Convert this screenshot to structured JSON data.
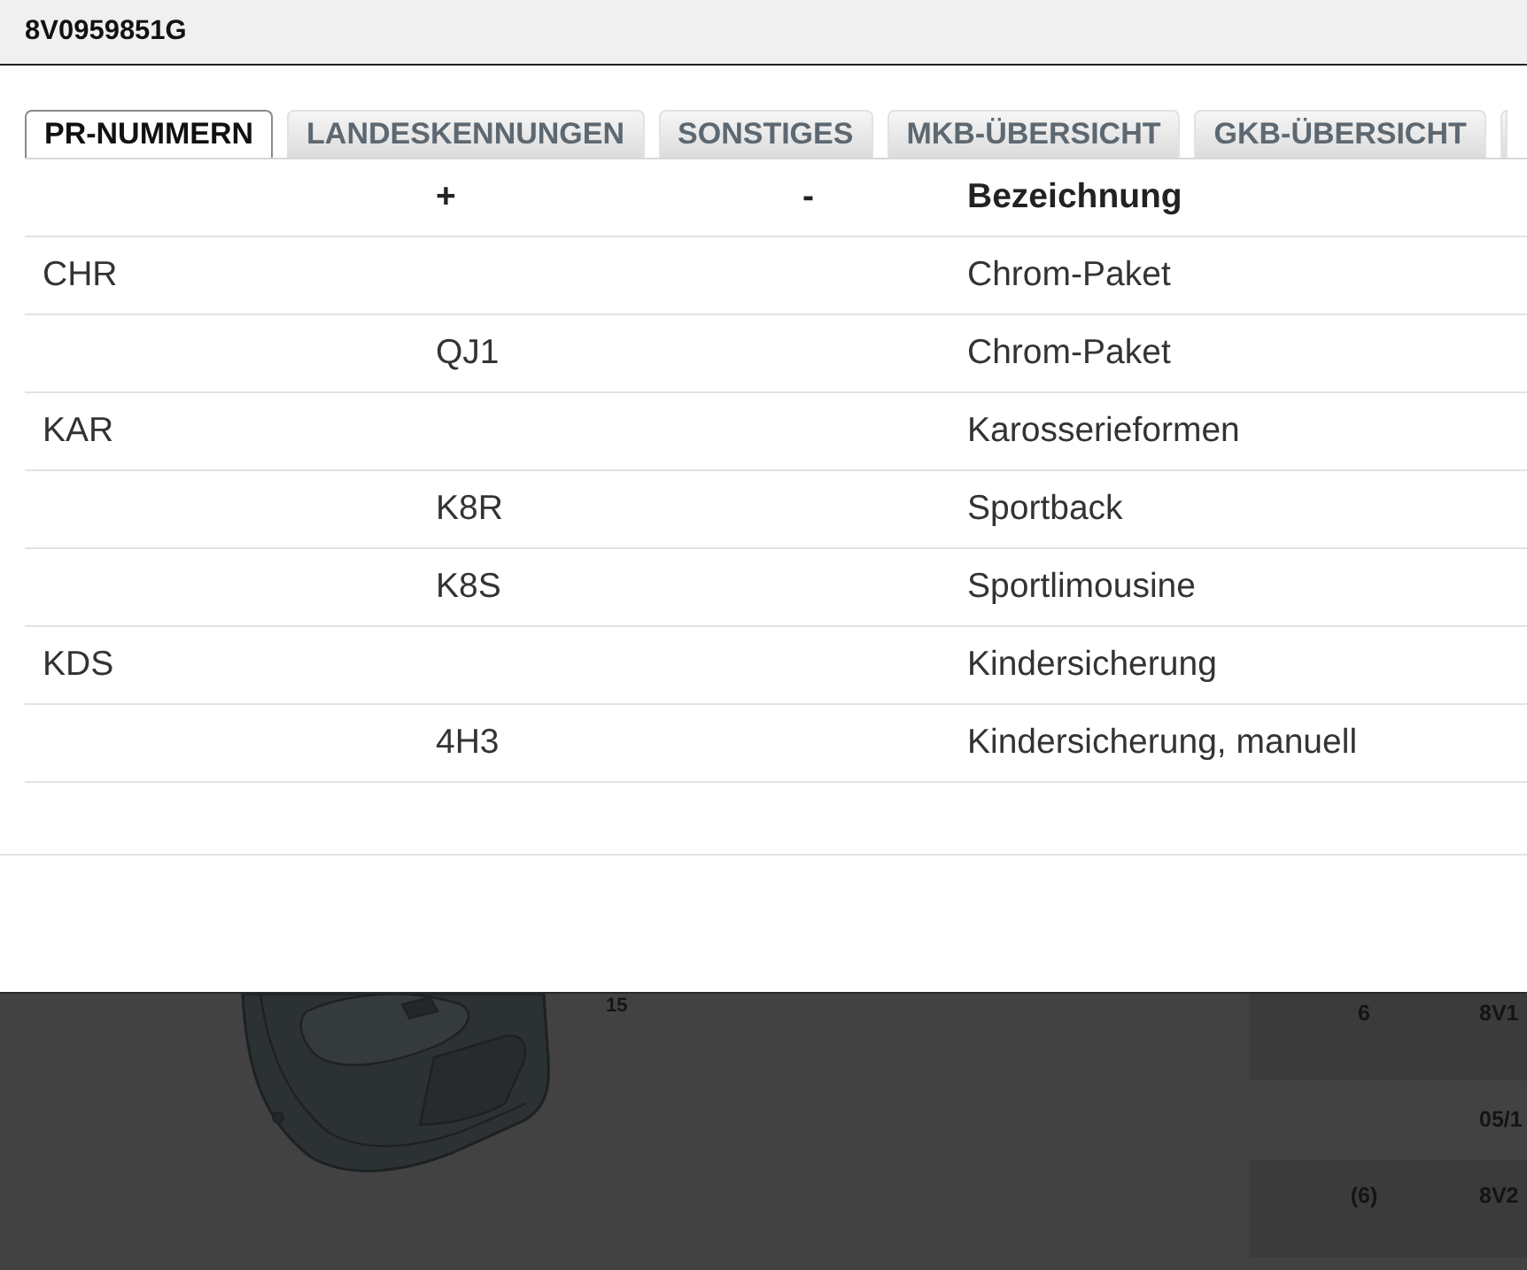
{
  "window": {
    "title": "8V0959851G"
  },
  "tabs": [
    {
      "label": "PR-NUMMERN",
      "selected": true
    },
    {
      "label": "LANDESKENNUNGEN",
      "selected": false
    },
    {
      "label": "SONSTIGES",
      "selected": false
    },
    {
      "label": "MKB-ÜBERSICHT",
      "selected": false
    },
    {
      "label": "GKB-ÜBERSICHT",
      "selected": false
    }
  ],
  "table": {
    "columns": [
      {
        "label": "+"
      },
      {
        "label": "-"
      },
      {
        "label": "Bezeichnung"
      }
    ],
    "rows": [
      {
        "family": "CHR",
        "description": "Chrom-Paket"
      },
      {
        "plus": "QJ1",
        "description": "Chrom-Paket"
      },
      {
        "family": "KAR",
        "description": "Karosserieformen"
      },
      {
        "plus": "K8R",
        "description": "Sportback"
      },
      {
        "plus": "K8S",
        "description": "Sportlimousine"
      },
      {
        "family": "KDS",
        "description": "Kindersicherung"
      },
      {
        "plus": "4H3",
        "description": "Kindersicherung, manuell"
      }
    ]
  },
  "background_page": {
    "callout": "15",
    "rows": [
      {
        "column_1": "6",
        "column_2": "8V1"
      },
      {
        "column_2": "05/1"
      },
      {
        "column_1": "(6)",
        "column_2": "8V2"
      }
    ]
  }
}
